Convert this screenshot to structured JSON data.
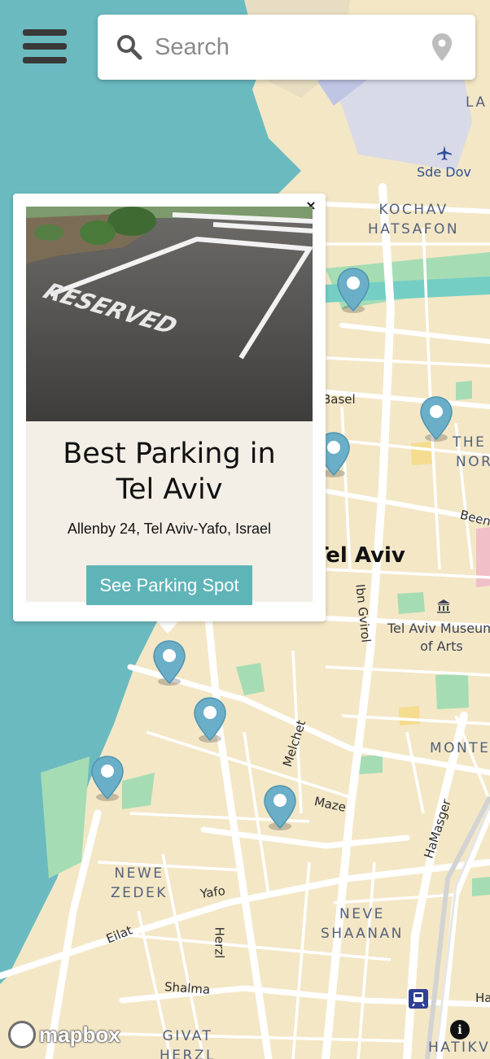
{
  "search": {
    "placeholder": "Search",
    "value": ""
  },
  "menu": {
    "icon": "hamburger-icon"
  },
  "map": {
    "city_label": "Tel Aviv",
    "districts": [
      "LA",
      "KOCHAV",
      "HATSAFON",
      "THE",
      "NOR",
      "MONTE",
      "NEWE",
      "ZEDEK",
      "NEVE",
      "SHAANAN",
      "GIVAT",
      "HERZL",
      "HATIKV"
    ],
    "streets": [
      "Basel",
      "Been",
      "Ibn Gvirol",
      "Melchet",
      "Maze",
      "HaMasger",
      "Yafo",
      "Eilat",
      "Herzl",
      "Shalma",
      "Ha",
      "Ha"
    ],
    "pois": {
      "airport": "Sde Dov",
      "museum_line1": "Tel Aviv Museum",
      "museum_line2": "of Arts"
    },
    "colors": {
      "sea": "#6bbac0",
      "land": "#f3e7c6",
      "road": "#ffffff",
      "park": "#a6dcb4",
      "river": "#74cec4",
      "pin": "#6aaec8"
    },
    "pin_count": 7
  },
  "popup": {
    "close_label": "×",
    "photo_text": "RESERVED",
    "title_line1": "Best Parking in",
    "title_line2": "Tel Aviv",
    "address": "Allenby 24, Tel Aviv-Yafo, Israel",
    "button_label": "See Parking Spot"
  },
  "attribution": {
    "logo_text": "mapbox",
    "info_label": "i"
  }
}
